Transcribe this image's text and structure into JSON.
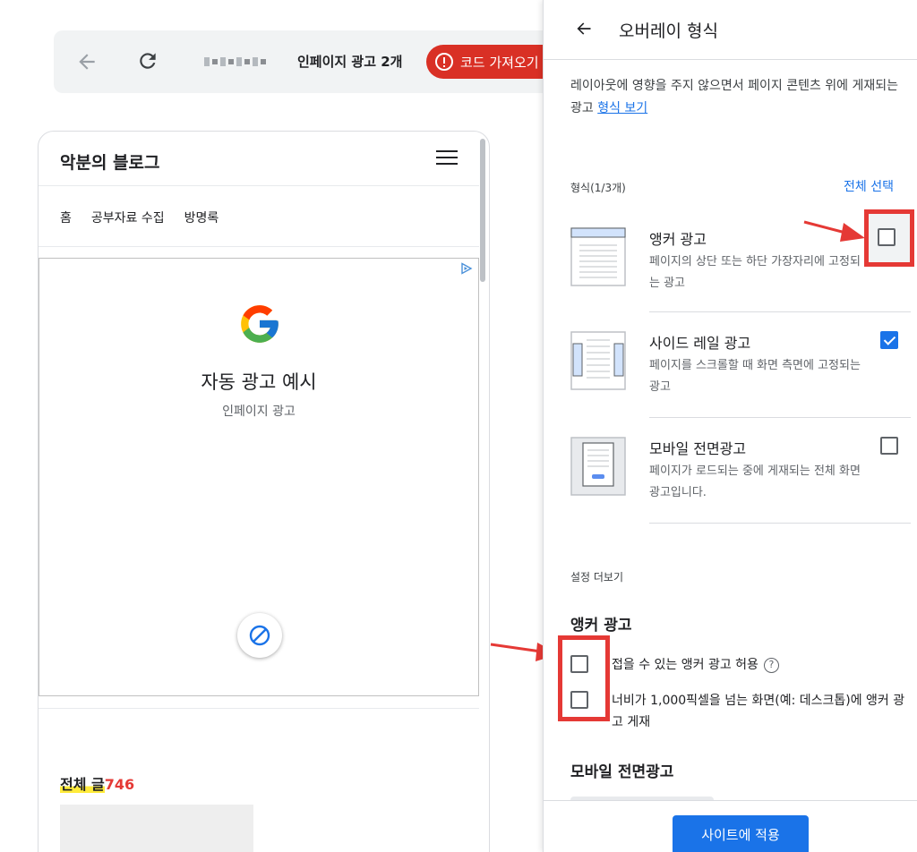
{
  "toolbar": {
    "title": "인페이지 광고 2개",
    "error_label": "코드 가져오기"
  },
  "preview": {
    "blog_title": "악분의 블로그",
    "nav_items": [
      "홈",
      "공부자료 수집",
      "방명록"
    ],
    "ad_title": "자동 광고 예시",
    "ad_subtitle": "인페이지 광고",
    "posts_label": "전체 글",
    "posts_count": "746"
  },
  "panel": {
    "title": "오버레이 형식",
    "description": "레이아웃에 영향을 주지 않으면서 페이지 콘텐츠 위에 게재되는 광고 ",
    "description_link": "형식 보기",
    "formats_label": "형식(1/3개)",
    "select_all": "전체 선택",
    "options": [
      {
        "name": "앵커 광고",
        "desc": "페이지의 상단 또는 하단 가장자리에 고정되는 광고",
        "checked": false
      },
      {
        "name": "사이드 레일 광고",
        "desc": "페이지를 스크롤할 때 화면 측면에 고정되는 광고",
        "checked": true
      },
      {
        "name": "모바일 전면광고",
        "desc": "페이지가 로드되는 중에 게재되는 전체 화면 광고입니다.",
        "checked": false
      }
    ],
    "more_settings": "설정 더보기",
    "anchor_section": "앵커 광고",
    "anchor_options": [
      {
        "text": "접을 수 있는 앵커 광고 허용",
        "checked": false
      },
      {
        "text": "너비가 1,000픽셀을 넘는 화면(예: 데스크톱)에 앵커 광고 게재",
        "checked": false
      }
    ],
    "mobile_section": "모바일 전면광고",
    "apply_button": "사이트에 적용"
  },
  "colors": {
    "accent": "#1a73e8",
    "error": "#d93025",
    "highlight": "#e53935"
  },
  "icons": [
    "back-arrow-icon",
    "reload-icon",
    "error-icon",
    "hamburger-icon",
    "ad-choices-icon",
    "google-logo-icon",
    "block-icon",
    "help-icon"
  ]
}
